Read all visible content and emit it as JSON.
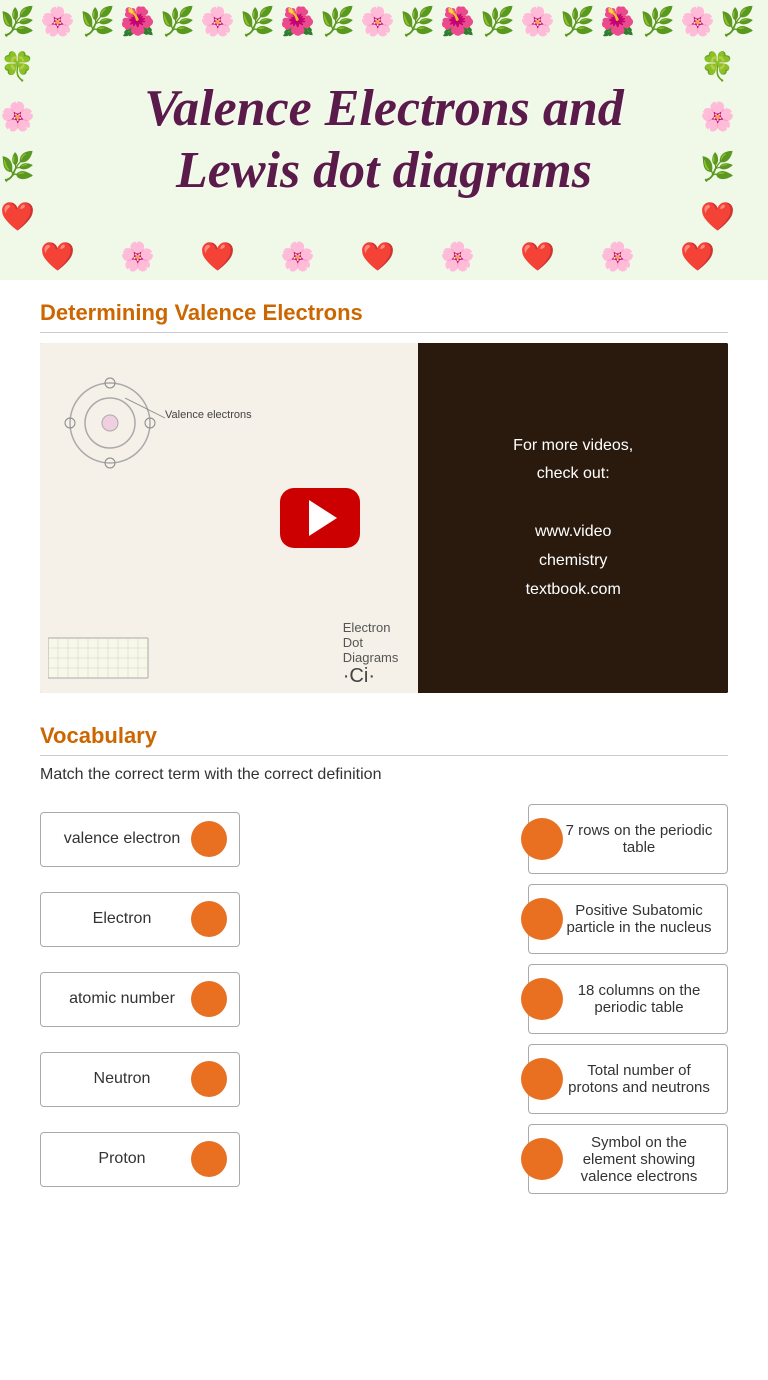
{
  "header": {
    "title_line1": "Valence Electrons and",
    "title_line2": "Lewis dot diagrams"
  },
  "section1": {
    "title": "Determining Valence Electrons"
  },
  "video": {
    "right_text_line1": "For more videos,",
    "right_text_line2": "check out:",
    "right_text_line3": "",
    "right_text_url": "www.video",
    "right_text_url2": "chemistry",
    "right_text_url3": "textbook.com"
  },
  "section2": {
    "title": "Vocabulary",
    "description": "Match the correct term with the correct definition"
  },
  "terms": [
    {
      "label": "valence electron"
    },
    {
      "label": "Electron"
    },
    {
      "label": "atomic number"
    },
    {
      "label": "Neutron"
    },
    {
      "label": "Proton"
    }
  ],
  "definitions": [
    {
      "text": "7 rows on the periodic table"
    },
    {
      "text": "Positive Subatomic particle in the nucleus"
    },
    {
      "text": "18 columns on the periodic table"
    },
    {
      "text": "Total number of protons and neutrons"
    },
    {
      "text": "Symbol on the element showing valence electrons"
    }
  ]
}
